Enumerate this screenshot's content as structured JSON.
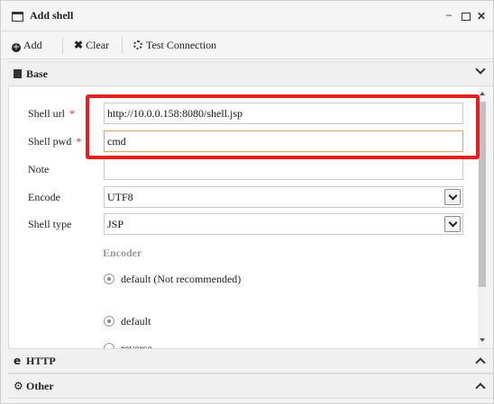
{
  "window": {
    "title": "Add shell"
  },
  "toolbar": {
    "add_label": "Add",
    "clear_label": "Clear",
    "test_label": "Test Connection"
  },
  "sections": {
    "base": "Base",
    "http": "HTTP",
    "other": "Other"
  },
  "form": {
    "shell_url": {
      "label": "Shell url",
      "required": "*",
      "value": "http://10.0.0.158:8080/shell.jsp"
    },
    "shell_pwd": {
      "label": "Shell pwd",
      "required": "*",
      "value": "cmd"
    },
    "note": {
      "label": "Note",
      "value": ""
    },
    "encode": {
      "label": "Encode",
      "value": "UTF8"
    },
    "shell_type": {
      "label": "Shell type",
      "value": "JSP"
    },
    "encoder_heading": "Encoder",
    "encoder_options": [
      {
        "label": "default (Not recommended)",
        "selected": true
      },
      {
        "label": "default",
        "selected": true
      },
      {
        "label": "reverse",
        "selected": false
      }
    ]
  },
  "colors": {
    "highlight": "#e41f1f",
    "required": "#d9262b",
    "focus": "#e0a55a"
  }
}
